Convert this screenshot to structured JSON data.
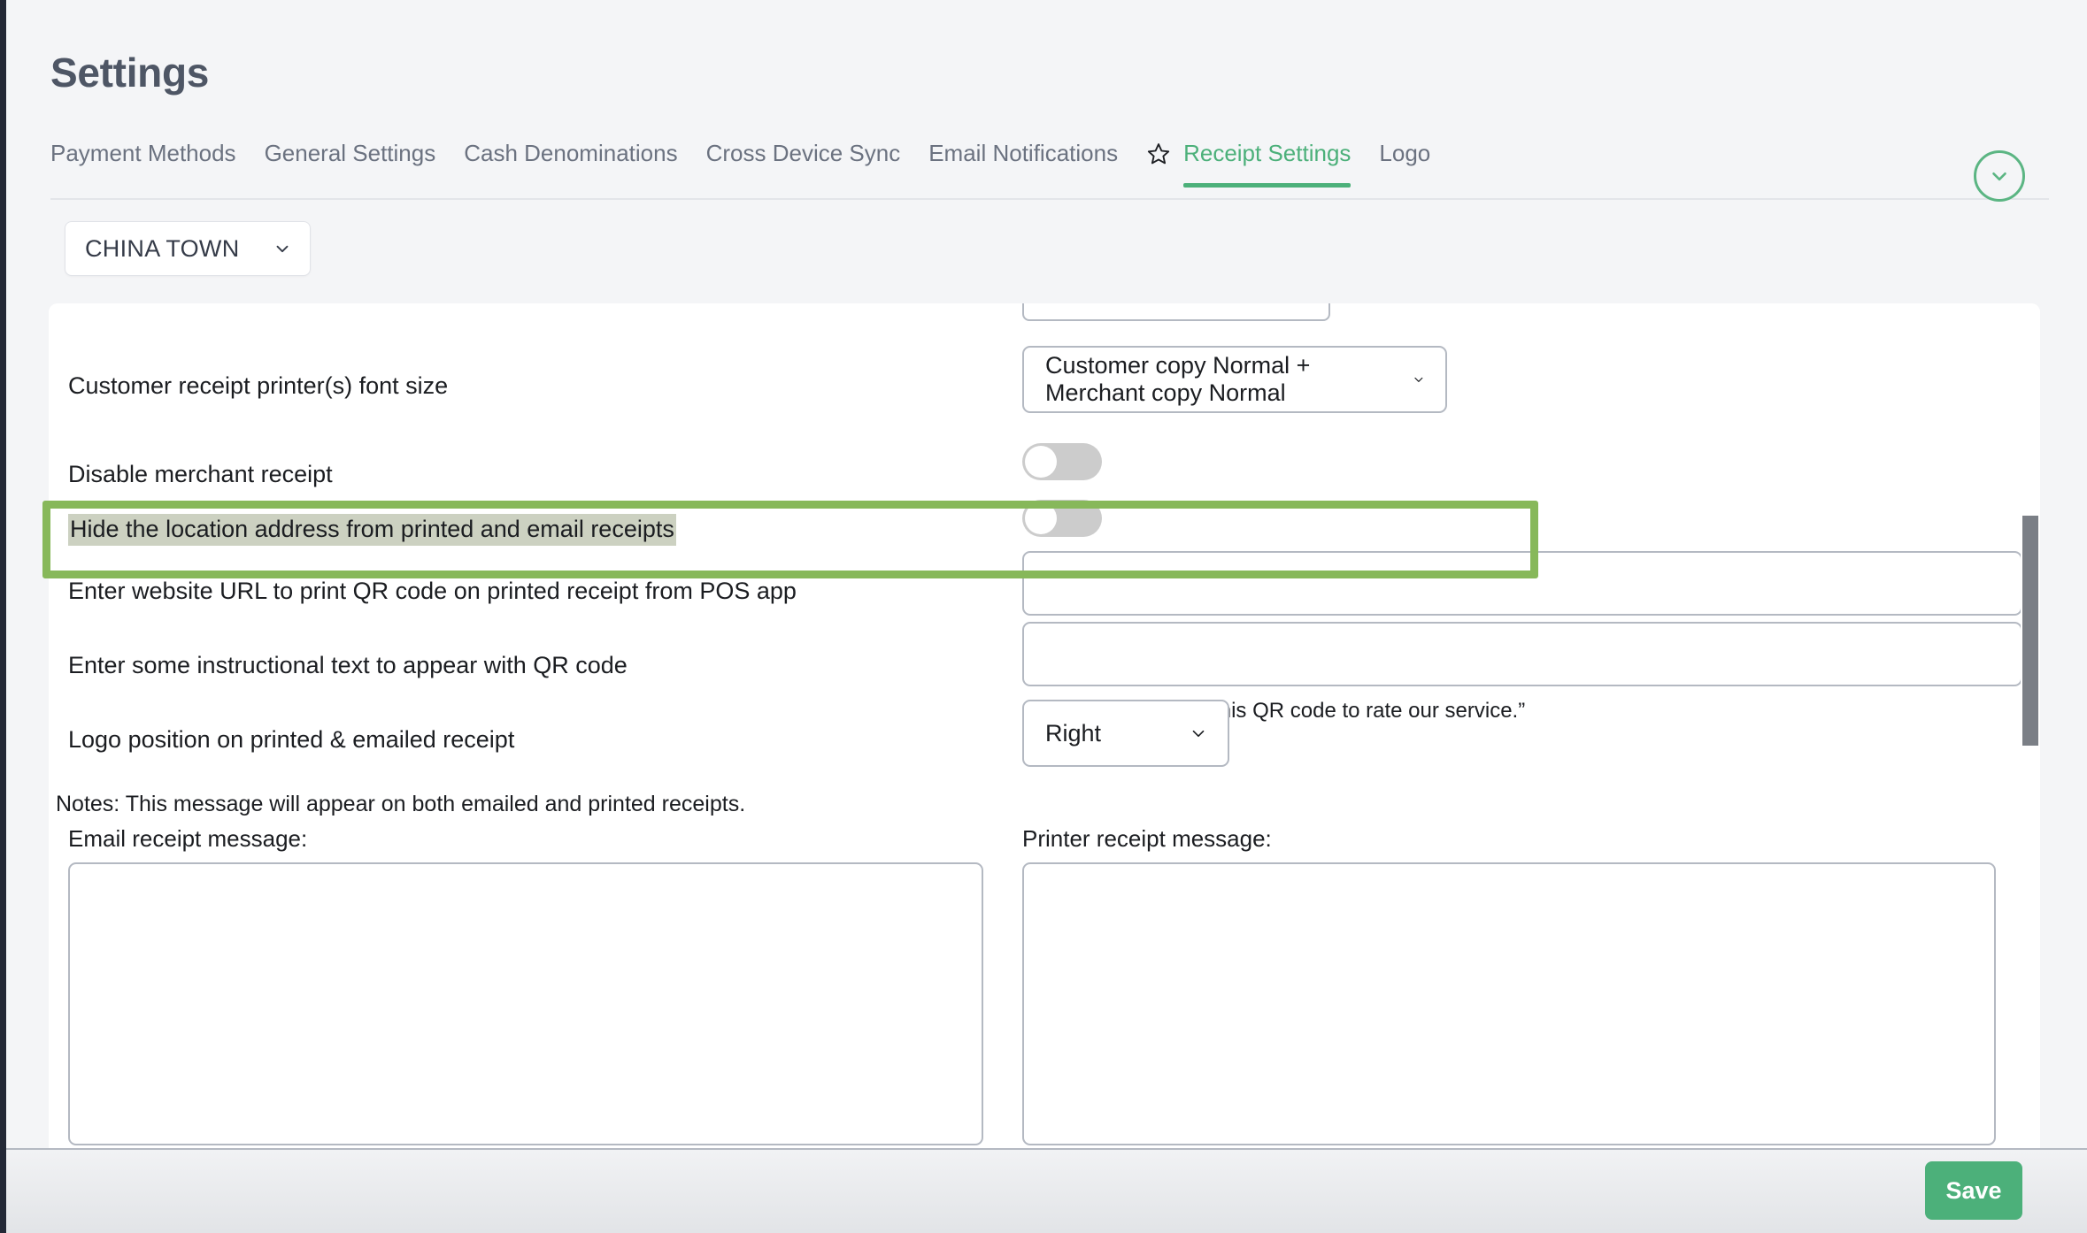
{
  "header": {
    "title": "Settings"
  },
  "tabs": [
    {
      "label": "Payment Methods",
      "active": false
    },
    {
      "label": "General Settings",
      "active": false
    },
    {
      "label": "Cash Denominations",
      "active": false
    },
    {
      "label": "Cross Device Sync",
      "active": false
    },
    {
      "label": "Email Notifications",
      "active": false
    },
    {
      "label": "Receipt Settings",
      "active": true
    },
    {
      "label": "Logo",
      "active": false
    }
  ],
  "icons": {
    "favorite": "star-outline-icon",
    "collapse": "chevron-down-icon",
    "select_caret": "chevron-down-icon"
  },
  "location_select": {
    "value": "CHINA TOWN"
  },
  "settings": {
    "font_size": {
      "label": "Customer receipt printer(s) font size",
      "value": "Customer copy Normal + Merchant copy Normal"
    },
    "disable_merchant_receipt": {
      "label": "Disable merchant receipt",
      "state": "off"
    },
    "hide_location_address": {
      "label": "Hide the location address from printed and email receipts",
      "state": "off",
      "highlighted": true,
      "highlight_color": "#87b85a",
      "text_highlight_color": "#ccd1c1"
    },
    "qr_url": {
      "label": "Enter website URL to print QR code on printed receipt from POS app",
      "value": "",
      "placeholder": ""
    },
    "qr_instructional": {
      "label": "Enter some instructional text to appear with QR code",
      "value": "",
      "placeholder": "",
      "hint": "For example: “Scan this QR code to rate our service.”"
    },
    "logo_position": {
      "label": "Logo position on printed & emailed receipt",
      "value": "Right"
    },
    "notes": "Notes: This message will appear on both emailed and printed receipts.",
    "email_receipt_message": {
      "label": "Email receipt message:",
      "value": "",
      "placeholder": ""
    },
    "printer_receipt_message": {
      "label": "Printer receipt message:",
      "value": "",
      "placeholder": ""
    }
  },
  "footer": {
    "save_label": "Save"
  },
  "colors": {
    "accent_green": "#4cb07a",
    "highlight_green": "#87b85a",
    "page_background": "#f4f5f7",
    "title_gray": "#4e5665",
    "tab_gray": "#6b7280"
  }
}
